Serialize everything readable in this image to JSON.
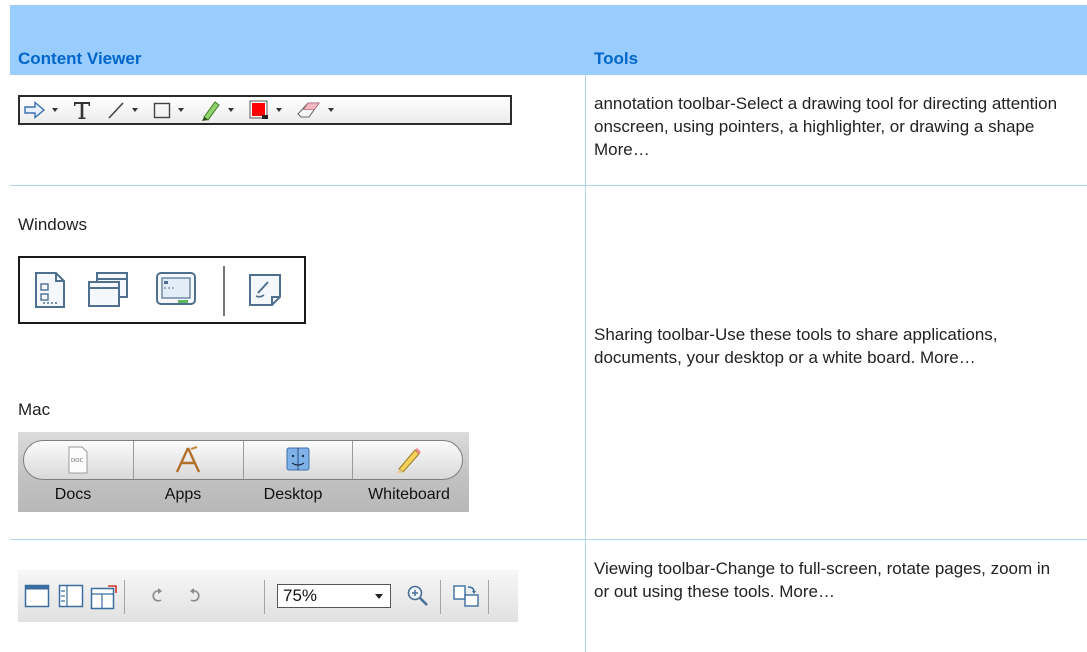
{
  "header": {
    "col_left": "Content Viewer",
    "col_right": "Tools"
  },
  "rows": {
    "annotation": {
      "description": "annotation toolbar-Select a drawing tool for directing attention onscreen, using pointers, a highlighter, or drawing a shape More…",
      "tools": [
        "pointer-arrow-icon",
        "text-tool-icon",
        "line-tool-icon",
        "rectangle-tool-icon",
        "highlighter-pen-icon",
        "color-picker-icon",
        "eraser-icon"
      ],
      "color_swatch": "#ff0000"
    },
    "sharing": {
      "windows_label": "Windows",
      "mac_label": "Mac",
      "description": "Sharing toolbar-Use these tools to share applications, documents, your desktop or a white board. More…",
      "windows_buttons": [
        "share-document-icon",
        "share-application-icon",
        "share-desktop-icon",
        "share-whiteboard-icon"
      ],
      "mac_buttons": [
        "Docs",
        "Apps",
        "Desktop",
        "Whiteboard"
      ]
    },
    "viewing": {
      "description": "Viewing toolbar-Change to full-screen, rotate pages, zoom in or out using these tools. More…",
      "zoom_value": "75%"
    }
  },
  "colors": {
    "header_band": "#99ccff",
    "header_text": "#0066cc",
    "grid_line": "#b0d4f5"
  }
}
